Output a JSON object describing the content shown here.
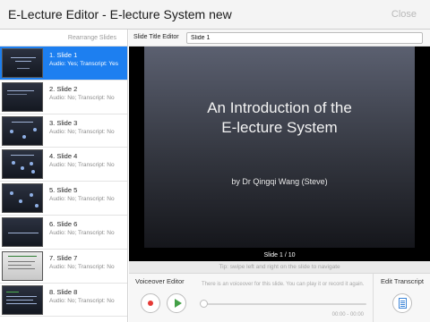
{
  "app": {
    "title": "E-Lecture Editor - E-lecture System new",
    "close_label": "Close"
  },
  "sidebar": {
    "rearrange_label": "Rearrange Slides",
    "items": [
      {
        "title": "1. Slide 1",
        "subtitle": "Audio: Yes; Transcript: Yes",
        "selected": true
      },
      {
        "title": "2. Slide 2",
        "subtitle": "Audio: No; Transcript: No",
        "selected": false
      },
      {
        "title": "3. Slide 3",
        "subtitle": "Audio: No; Transcript: No",
        "selected": false
      },
      {
        "title": "4. Slide 4",
        "subtitle": "Audio: No; Transcript: No",
        "selected": false
      },
      {
        "title": "5. Slide 5",
        "subtitle": "Audio: No; Transcript: No",
        "selected": false
      },
      {
        "title": "6. Slide 6",
        "subtitle": "Audio: No; Transcript: No",
        "selected": false
      },
      {
        "title": "7. Slide 7",
        "subtitle": "Audio: No; Transcript: No",
        "selected": false
      },
      {
        "title": "8. Slide 8",
        "subtitle": "Audio: No; Transcript: No",
        "selected": false
      }
    ]
  },
  "title_editor": {
    "label": "Slide Title Editor",
    "value": "Slide 1"
  },
  "slide": {
    "heading_line1": "An Introduction of the",
    "heading_line2": "E-lecture System",
    "author": "by Dr Qingqi Wang (Steve)",
    "page_indicator": "Slide 1 / 10",
    "tip": "Tip: swipe left and right on the slide to navigate"
  },
  "voiceover": {
    "title": "Voiceover Editor",
    "message": "There is an voiceover for this slide. You can play it or record it again.",
    "time": "00:00 - 00:00",
    "progress": 0
  },
  "transcript": {
    "title": "Edit Transcript"
  },
  "colors": {
    "accent": "#1d7ff0",
    "record": "#e53935",
    "play": "#43a047"
  }
}
